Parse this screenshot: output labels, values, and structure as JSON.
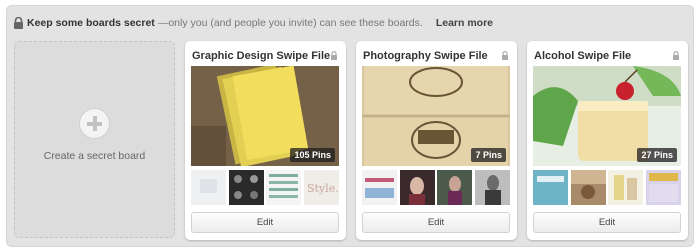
{
  "header": {
    "title": "Keep some boards secret",
    "subtitle": " —only you (and people you invite) can see these boards.",
    "learn_more": "Learn more"
  },
  "create_board": {
    "label": "Create a secret board",
    "icon": "plus-icon"
  },
  "boards": [
    {
      "title": "Graphic Design Swipe File",
      "count": "105 Pins",
      "edit": "Edit",
      "icon": "lock-icon"
    },
    {
      "title": "Photography Swipe File",
      "count": "7 Pins",
      "edit": "Edit",
      "icon": "lock-icon"
    },
    {
      "title": "Alcohol Swipe File",
      "count": "27 Pins",
      "edit": "Edit",
      "icon": "lock-icon"
    }
  ]
}
